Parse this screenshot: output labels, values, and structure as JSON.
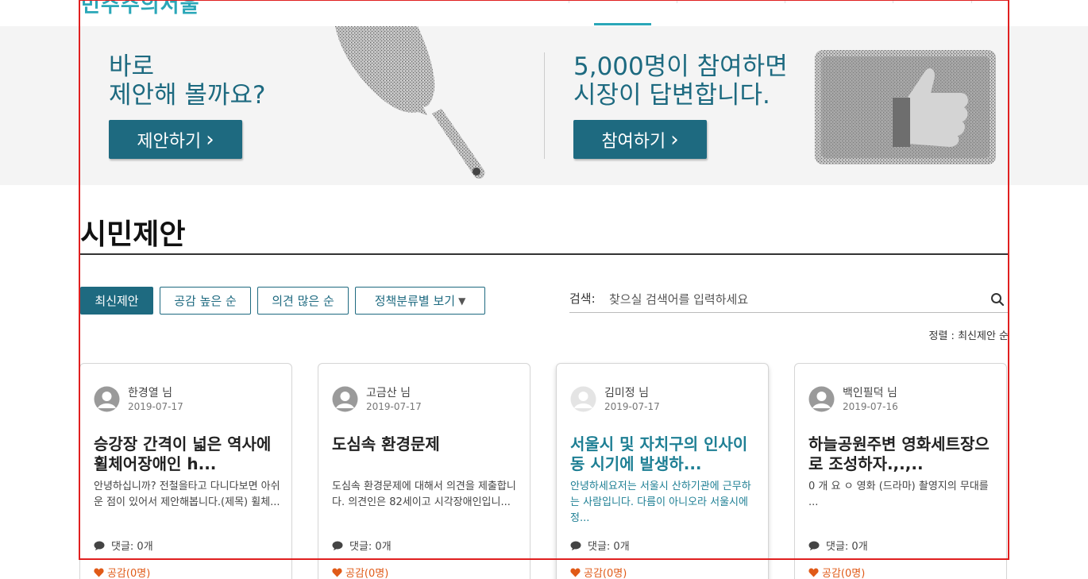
{
  "header": {
    "logo_text": "민주주의서울",
    "logo_dark": ""
  },
  "banner": {
    "left_line1": "바로",
    "left_line2": "제안해 볼까요?",
    "left_button": "제안하기",
    "right_line1": "5,000명이 참여하면",
    "right_line2": "시장이 답변합니다.",
    "right_button": "참여하기"
  },
  "page_title": "시민제안",
  "filters": [
    {
      "label": "최신제안",
      "active": true
    },
    {
      "label": "공감 높은 순",
      "active": false
    },
    {
      "label": "의견 많은 순",
      "active": false
    },
    {
      "label": "정책분류별 보기",
      "active": false
    }
  ],
  "search": {
    "label": "검색:",
    "placeholder": "찾으실 검색어를 입력하세요"
  },
  "sort": "정렬 : 최신제안 순",
  "cards": [
    {
      "author": "한경열 님",
      "date": "2019-07-17",
      "title": "승강장 간격이 넓은 역사에 휠체어장애인 h...",
      "body": "안녕하십니까? 전철을타고 다니다보면 아쉬운 점이 있어서 제안해봅니다.(제목) 휠체...",
      "comments": "댓글: 0개",
      "likes": "공감(0명)"
    },
    {
      "author": "고금산 님",
      "date": "2019-07-17",
      "title": "도심속 환경문제",
      "body": "도심속 환경문제에 대해서 의견을 제출합니다. 의견인은 82세이고 시각장애인입니...",
      "comments": "댓글: 0개",
      "likes": "공감(0명)"
    },
    {
      "author": "김미정 님",
      "date": "2019-07-17",
      "title": "서울시 및 자치구의 인사이동 시기에 발생하...",
      "body": "안녕하세요저는 서울시 산하기관에 근무하는 사람입니다. 다름이 아니오라 서울시에 정...",
      "comments": "댓글: 0개",
      "likes": "공감(0명)"
    },
    {
      "author": "백인필덕 님",
      "date": "2019-07-16",
      "title": "하늘공원주변 영화세트장으로 조성하자.,.,..",
      "body": "0 개 요 ㅇ 영화 (드라마) 촬영지의 무대를 ...",
      "comments": "댓글: 0개",
      "likes": "공감(0명)"
    }
  ],
  "colors": {
    "primary": "#1e6a80",
    "accent": "#2aa7b8",
    "like": "#e05a17",
    "frame": "#e02020"
  }
}
